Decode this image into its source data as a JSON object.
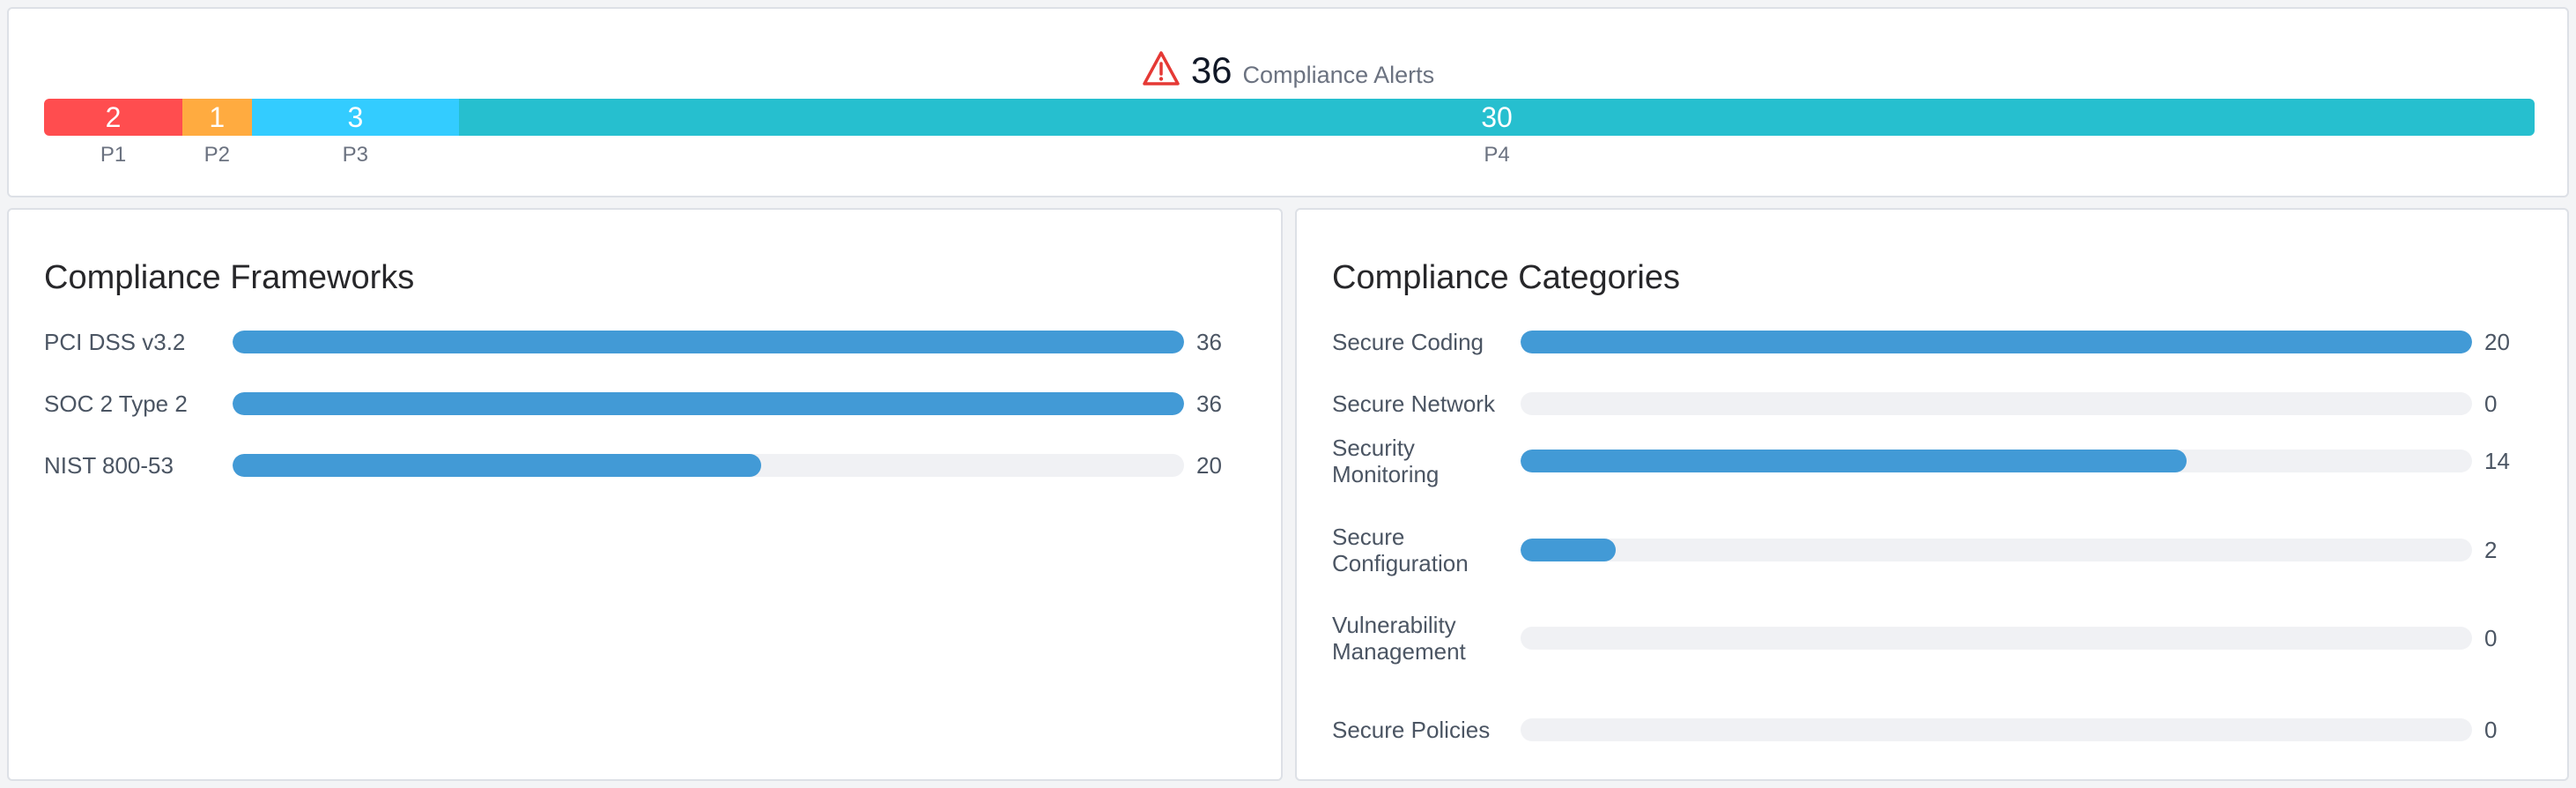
{
  "alerts": {
    "total": "36",
    "label": "Compliance Alerts",
    "icon": "warning-icon",
    "segments": [
      {
        "label": "P1",
        "count": 2,
        "color": "#ff4d4f"
      },
      {
        "label": "P2",
        "count": 1,
        "color": "#ffab40"
      },
      {
        "label": "P3",
        "count": 3,
        "color": "#33ccff"
      },
      {
        "label": "P4",
        "count": 30,
        "color": "#26bfcf"
      }
    ]
  },
  "frameworks": {
    "title": "Compliance Frameworks",
    "max": 36,
    "items": [
      {
        "label": "PCI DSS v3.2",
        "value": 36
      },
      {
        "label": "SOC 2 Type 2",
        "value": 36
      },
      {
        "label": "NIST 800-53",
        "value": 20
      }
    ]
  },
  "categories": {
    "title": "Compliance Categories",
    "max": 20,
    "items": [
      {
        "label": "Secure Coding",
        "value": 20
      },
      {
        "label": "Secure Network",
        "value": 0
      },
      {
        "label": "Security Monitoring",
        "value": 14
      },
      {
        "label": "Secure Configuration",
        "value": 2
      },
      {
        "label": "Vulnerability Management",
        "value": 0
      },
      {
        "label": "Secure Policies",
        "value": 0
      }
    ]
  },
  "colors": {
    "bar_fill": "#429ad6",
    "bar_track": "#f0f1f4",
    "warning": "#e53935"
  }
}
